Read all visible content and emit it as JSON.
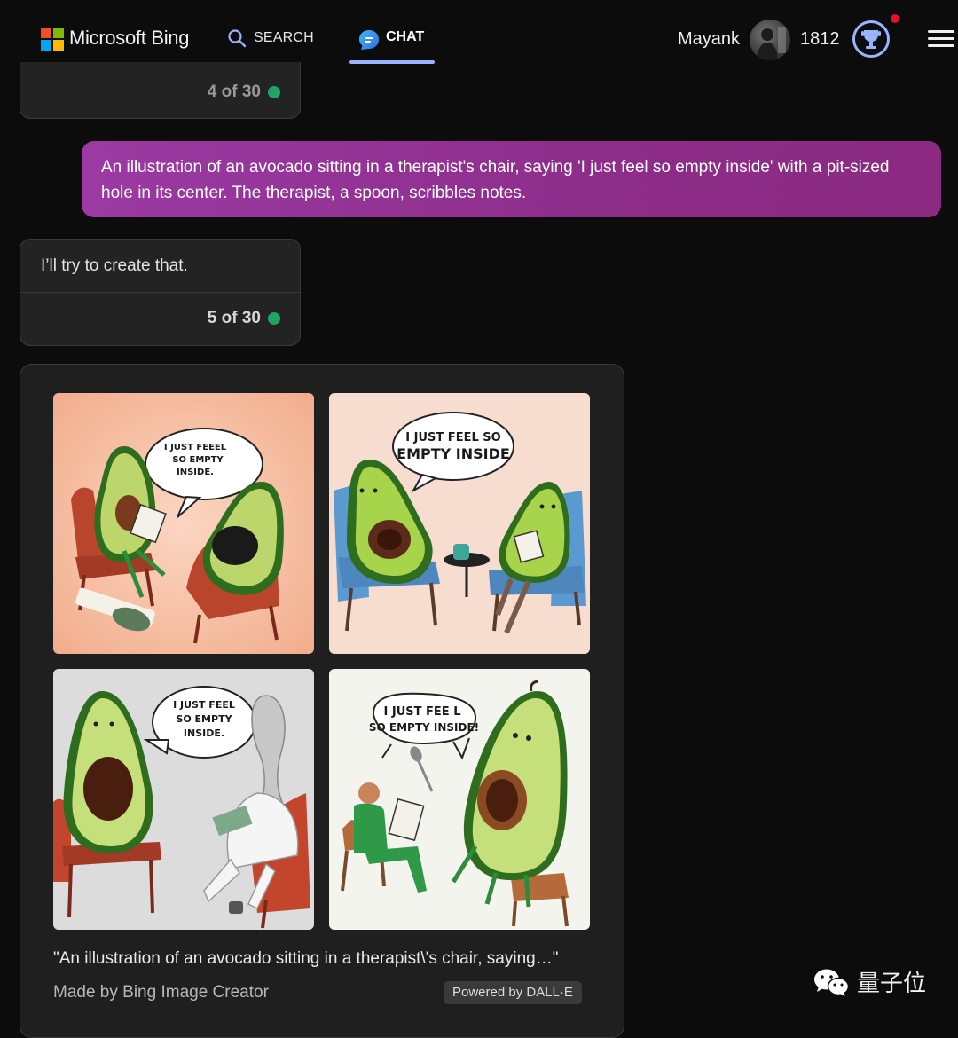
{
  "header": {
    "brand": "Microsoft Bing",
    "nav": {
      "search_label": "SEARCH",
      "chat_label": "CHAT"
    },
    "user": {
      "name": "Mayank",
      "points": "1812"
    }
  },
  "chat": {
    "previous_counter": "4 of 30",
    "user_message": "An illustration of an avocado sitting in a therapist's chair, saying 'I just feel so empty inside' with a pit-sized hole in its center. The therapist, a spoon, scribbles notes.",
    "reply_text": "I’ll try to create that.",
    "reply_counter": "5 of 30",
    "images": {
      "tiles": [
        {
          "bubble": [
            "I JUST FEEEL",
            "SO EMPTY",
            "INSIDE."
          ]
        },
        {
          "bubble": [
            "I JUST FEEL SO",
            "EMPTY INSIDE"
          ]
        },
        {
          "bubble": [
            "I JUST FEEL",
            "SO EMPTY",
            "INSIDE."
          ]
        },
        {
          "bubble": [
            "I JUST FEE L",
            "SO EMPTY INSIDE!"
          ]
        }
      ],
      "caption": "\"An illustration of an avocado sitting in a therapist\\'s chair, saying…\"",
      "made_by": "Made by Bing Image Creator",
      "powered_by": "Powered by DALL·E"
    }
  },
  "watermark": {
    "text": "量子位"
  },
  "colors": {
    "accent_underline": "#9ab3ff",
    "user_bubble": "#8d2d8a",
    "status_dot": "#21a366",
    "notification_dot": "#e81123"
  },
  "icons": [
    "search-icon",
    "chat-icon",
    "rewards-trophy-icon",
    "hamburger-menu-icon",
    "wechat-icon"
  ]
}
